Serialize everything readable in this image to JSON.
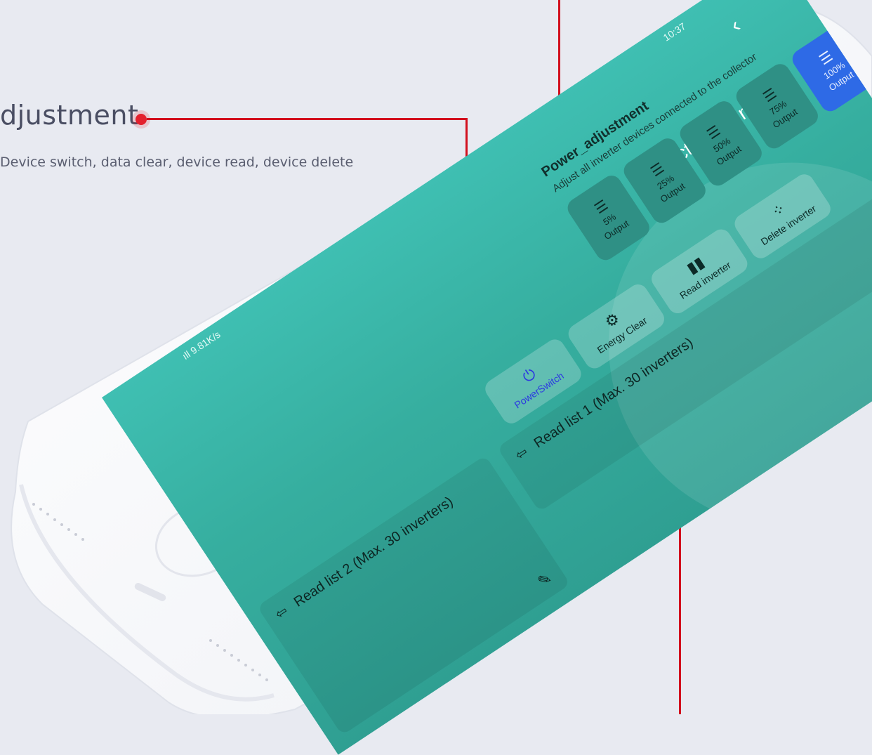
{
  "annotation": {
    "title": "djustment",
    "description": "Device switch, data clear, device read, device delete"
  },
  "status": {
    "signal": "ıll 9.81K/s",
    "time": "10:37"
  },
  "header": {
    "back_icon": "chevron-left-icon",
    "title": "Collector settings"
  },
  "power_adjustment": {
    "title": "Power_adjustment",
    "subtitle": "Adjust all inverter devices connected to the collector",
    "outputs": [
      {
        "percent": "5%",
        "label": "Output",
        "active": false
      },
      {
        "percent": "25%",
        "label": "Output",
        "active": false
      },
      {
        "percent": "50%",
        "label": "Output",
        "active": false
      },
      {
        "percent": "75%",
        "label": "Output",
        "active": false
      },
      {
        "percent": "100%",
        "label": "Output",
        "active": true
      }
    ]
  },
  "functions": [
    {
      "label": "PowerSwitch",
      "icon": "power-icon"
    },
    {
      "label": "Energy Clear",
      "icon": "gear-icon"
    },
    {
      "label": "Read inverter",
      "icon": "book-icon"
    },
    {
      "label": "Delete inverter",
      "icon": "grid-dots-icon"
    }
  ],
  "read_lists": [
    {
      "title": "Read list 1 (Max. 30 inverters)"
    },
    {
      "title": "Read list 2 (Max. 30 inverters)"
    }
  ],
  "colors": {
    "screen": "#3fbfb2",
    "active_output": "#2e6ae6",
    "callout": "#d2101e",
    "power_text": "#2c39e0"
  }
}
